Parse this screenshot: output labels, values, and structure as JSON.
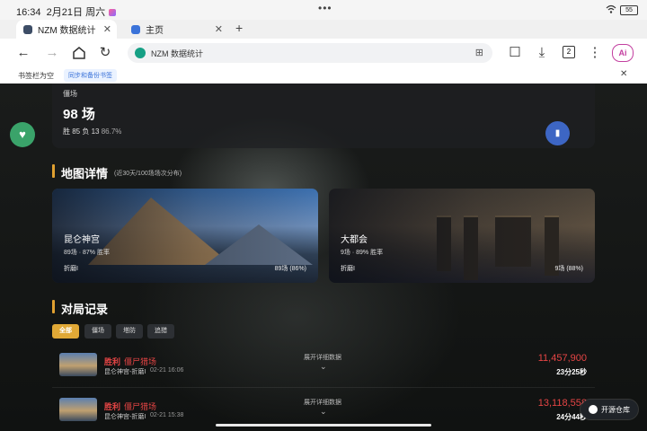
{
  "status_bar": {
    "time": "16:34",
    "date": "2月21日 周六",
    "battery": "55"
  },
  "tabs": [
    {
      "title": "NZM 数据统计",
      "active": true
    },
    {
      "title": "主页",
      "active": false
    }
  ],
  "toolbar": {
    "url": "NZM 数据统计",
    "tab_count": "2",
    "ai_label": "Ai"
  },
  "bookmarks": {
    "empty_label": "书签栏为空",
    "sync_label": "同步和备份书签"
  },
  "summary": {
    "label": "僵场",
    "count": "98 场",
    "record": "胜 85 负 13",
    "win_rate": "86.7%"
  },
  "map_section": {
    "title": "地图详情",
    "note": "(近30天/100场场次分布)",
    "maps": [
      {
        "name": "昆仑神宫",
        "rate": "89场 · 87% 胜率",
        "mode": "折磨I",
        "count": "89场 (86%)"
      },
      {
        "name": "大都会",
        "rate": "9场 · 89% 胜率",
        "mode": "折磨I",
        "count": "9场 (88%)"
      }
    ]
  },
  "match_section": {
    "title": "对局记录",
    "filters": [
      "全部",
      "僵场",
      "塔防",
      "追猎"
    ],
    "matches": [
      {
        "result": "胜利",
        "mode": "僵尸猎场",
        "map": "昆仑神宫-折磨I",
        "time": "02-21 16:06",
        "detail": "展开详细数据",
        "score": "11,457,900",
        "duration": "23分25秒"
      },
      {
        "result": "胜利",
        "mode": "僵尸猎场",
        "map": "昆仑神宫-折磨I",
        "time": "02-21 15:38",
        "detail": "展开详细数据",
        "score": "13,118,558",
        "duration": "24分44秒"
      }
    ]
  },
  "repo_button": {
    "label": "开源仓库"
  },
  "colors": {
    "accent": "#e0a836",
    "win": "#e64545",
    "heart": "#3aa36a",
    "ai": "#c33fa0"
  },
  "icons": [
    "wifi-icon",
    "battery-icon",
    "back-icon",
    "forward-icon",
    "home-icon",
    "reload-icon",
    "shield-icon",
    "bookmark-add-icon",
    "bookmark-icon",
    "download-icon",
    "more-icon",
    "heart-icon",
    "github-icon"
  ]
}
